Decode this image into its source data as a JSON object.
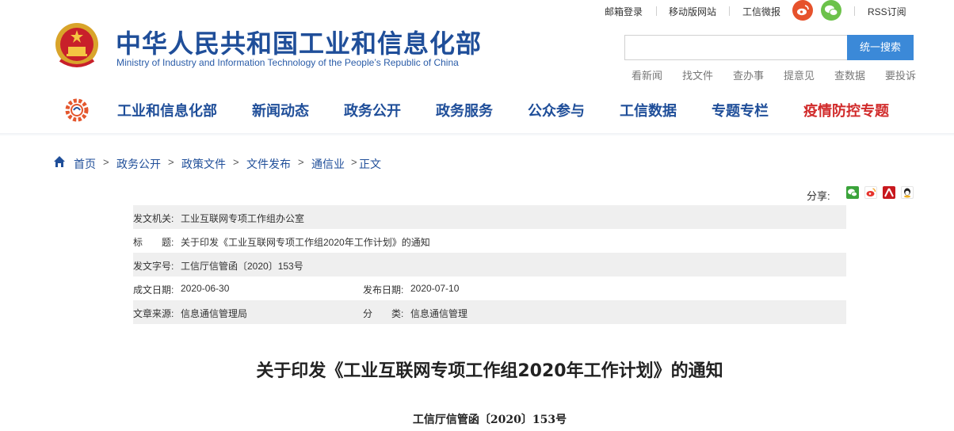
{
  "top_links": {
    "mail_login": "邮箱登录",
    "mobile_site": "移动版网站",
    "weibo": "工信微报",
    "rss": "RSS订阅"
  },
  "header": {
    "title": "中华人民共和国工业和信息化部",
    "subtitle": "Ministry of Industry and Information Technology of the People’s Republic of China"
  },
  "search": {
    "placeholder": "",
    "button_label": "统一搜索"
  },
  "quick_links": [
    "看新闻",
    "找文件",
    "查办事",
    "提意见",
    "查数据",
    "要投诉"
  ],
  "nav": {
    "items": [
      "工业和信息化部",
      "新闻动态",
      "政务公开",
      "政务服务",
      "公众参与",
      "工信数据",
      "专题专栏"
    ],
    "special": "疫情防控专题",
    "special_color": "#d12b2b",
    "primary_color": "#1f4e99"
  },
  "breadcrumb": [
    "首页",
    "政务公开",
    "政策文件",
    "文件发布",
    "通信业",
    "正文"
  ],
  "breadcrumb_separator": ">",
  "share": {
    "label": "分享:",
    "icons": [
      "wechat-icon",
      "weibo-icon",
      "renren-icon",
      "qq-icon"
    ]
  },
  "meta": {
    "issuer_label": "发文机关:",
    "issuer": "工业互联网专项工作组办公室",
    "title_label": "标　　题:",
    "title": "关于印发《工业互联网专项工作组2020年工作计划》的通知",
    "doc_no_label": "发文字号:",
    "doc_no": "工信厅信管函〔2020〕153号",
    "created_label": "成文日期:",
    "created": "2020-06-30",
    "published_label": "发布日期:",
    "published": "2020-07-10",
    "source_label": "文章来源:",
    "source": "信息通信管理局",
    "category_label": "分　　类:",
    "category": "信息通信管理"
  },
  "article": {
    "title": "关于印发《工业互联网专项工作组2020年工作计划》的通知",
    "doc_number": "工信厅信管函〔2020〕153号"
  }
}
